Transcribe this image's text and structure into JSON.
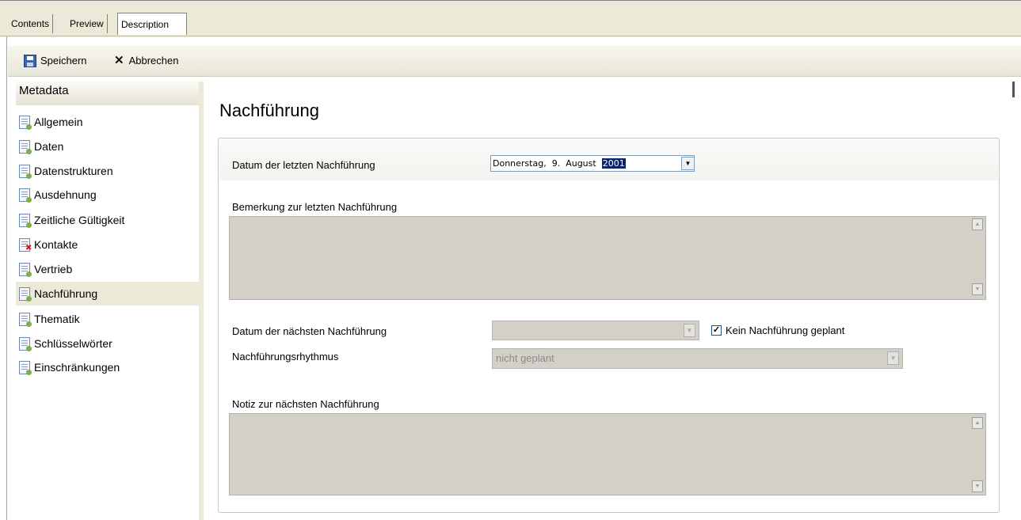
{
  "tabs": [
    {
      "label": "Contents"
    },
    {
      "label": "Preview"
    },
    {
      "label": "Description",
      "active": true
    }
  ],
  "toolbar": {
    "save_label": "Speichern",
    "save_icon": "save-icon",
    "cancel_label": "Abbrechen",
    "cancel_icon": "close-icon"
  },
  "sidebar": {
    "header": "Metadata",
    "items": [
      {
        "label": "Allgemein",
        "icon": "document-icon"
      },
      {
        "label": "Daten",
        "icon": "document-icon"
      },
      {
        "label": "Datenstrukturen",
        "icon": "document-icon"
      },
      {
        "label": "Ausdehnung",
        "icon": "document-icon"
      },
      {
        "label": "Zeitliche Gültigkeit",
        "icon": "document-icon"
      },
      {
        "label": "Kontakte",
        "icon": "document-error-icon"
      },
      {
        "label": "Vertrieb",
        "icon": "document-icon"
      },
      {
        "label": "Nachführung",
        "icon": "document-icon",
        "selected": true
      },
      {
        "label": "Thematik",
        "icon": "document-icon"
      },
      {
        "label": "Schlüsselwörter",
        "icon": "document-icon"
      },
      {
        "label": "Einschränkungen",
        "icon": "document-icon"
      }
    ]
  },
  "main": {
    "title": "Nachführung",
    "last_update_label": "Datum der letzten Nachführung",
    "last_update_value": {
      "weekday": "Donnerstag,",
      "day": "9.",
      "month": "August",
      "year": "2001"
    },
    "remark_label": "Bemerkung zur letzten Nachführung",
    "remark_value": "",
    "next_update_label": "Datum der nächsten Nachführung",
    "next_update_value": "",
    "no_update_checkbox_label": "Kein Nachführung geplant",
    "no_update_checked": true,
    "rhythm_label": "Nachführungsrhythmus",
    "rhythm_value": "nicht geplant",
    "note_label": "Notiz zur nächsten Nachführung",
    "note_value": ""
  }
}
